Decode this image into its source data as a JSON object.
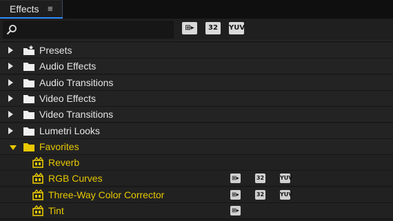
{
  "panel": {
    "tab_label": "Effects",
    "menu_glyph": "≡"
  },
  "toolbar": {
    "filter_accelerated": "⊞▸",
    "filter_32bit": "32",
    "filter_yuv": "YUV"
  },
  "tree": {
    "folders": [
      {
        "label": "Presets",
        "icon": "preset-folder-icon",
        "expanded": false
      },
      {
        "label": "Audio Effects",
        "icon": "folder-icon",
        "expanded": false
      },
      {
        "label": "Audio Transitions",
        "icon": "folder-icon",
        "expanded": false
      },
      {
        "label": "Video Effects",
        "icon": "folder-icon",
        "expanded": false
      },
      {
        "label": "Video Transitions",
        "icon": "folder-icon",
        "expanded": false
      },
      {
        "label": "Lumetri Looks",
        "icon": "folder-icon",
        "expanded": false
      },
      {
        "label": "Favorites",
        "icon": "folder-icon",
        "expanded": true
      }
    ],
    "favorites": [
      {
        "label": "Reverb",
        "accelerated": false,
        "bit32": false,
        "yuv": false
      },
      {
        "label": "RGB Curves",
        "accelerated": true,
        "bit32": true,
        "yuv": true
      },
      {
        "label": "Three-Way Color Corrector",
        "accelerated": true,
        "bit32": true,
        "yuv": true
      },
      {
        "label": "Tint",
        "accelerated": true,
        "bit32": false,
        "yuv": false
      }
    ],
    "badge_labels": {
      "accelerated": "⊞▸",
      "bit32": "32",
      "yuv": "YUV"
    }
  },
  "colors": {
    "accent_tab": "#2d8cff",
    "favorite_yellow": "#e8c800",
    "panel_bg": "#1c1c1c"
  }
}
